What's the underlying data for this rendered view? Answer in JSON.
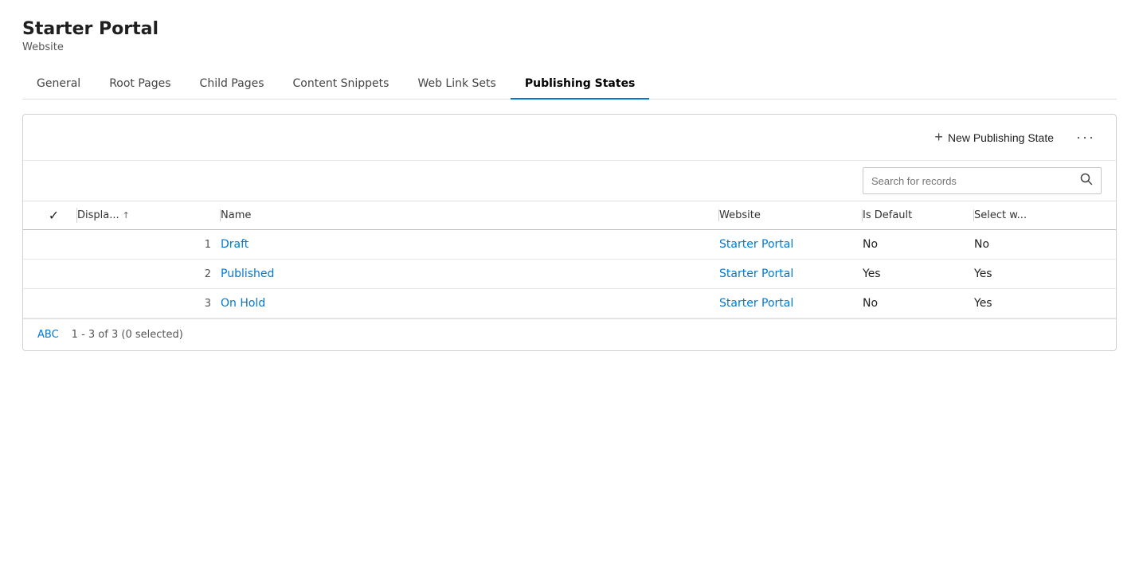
{
  "header": {
    "title": "Starter Portal",
    "subtitle": "Website"
  },
  "tabs": [
    {
      "id": "general",
      "label": "General",
      "active": false
    },
    {
      "id": "root-pages",
      "label": "Root Pages",
      "active": false
    },
    {
      "id": "child-pages",
      "label": "Child Pages",
      "active": false
    },
    {
      "id": "content-snippets",
      "label": "Content Snippets",
      "active": false
    },
    {
      "id": "web-link-sets",
      "label": "Web Link Sets",
      "active": false
    },
    {
      "id": "publishing-states",
      "label": "Publishing States",
      "active": true
    }
  ],
  "toolbar": {
    "new_label": "New Publishing State",
    "plus_icon": "+",
    "ellipsis": "···"
  },
  "search": {
    "placeholder": "Search for records"
  },
  "table": {
    "columns": [
      {
        "id": "check",
        "label": ""
      },
      {
        "id": "display",
        "label": "Displa...↑"
      },
      {
        "id": "name",
        "label": "Name"
      },
      {
        "id": "website",
        "label": "Website"
      },
      {
        "id": "is_default",
        "label": "Is Default"
      },
      {
        "id": "select_w",
        "label": "Select w..."
      }
    ],
    "rows": [
      {
        "num": "1",
        "name": "Draft",
        "website": "Starter Portal",
        "is_default": "No",
        "select_w": "No"
      },
      {
        "num": "2",
        "name": "Published",
        "website": "Starter Portal",
        "is_default": "Yes",
        "select_w": "Yes"
      },
      {
        "num": "3",
        "name": "On Hold",
        "website": "Starter Portal",
        "is_default": "No",
        "select_w": "Yes"
      }
    ]
  },
  "footer": {
    "abc": "ABC",
    "count": "1 - 3 of 3 (0 selected)"
  }
}
